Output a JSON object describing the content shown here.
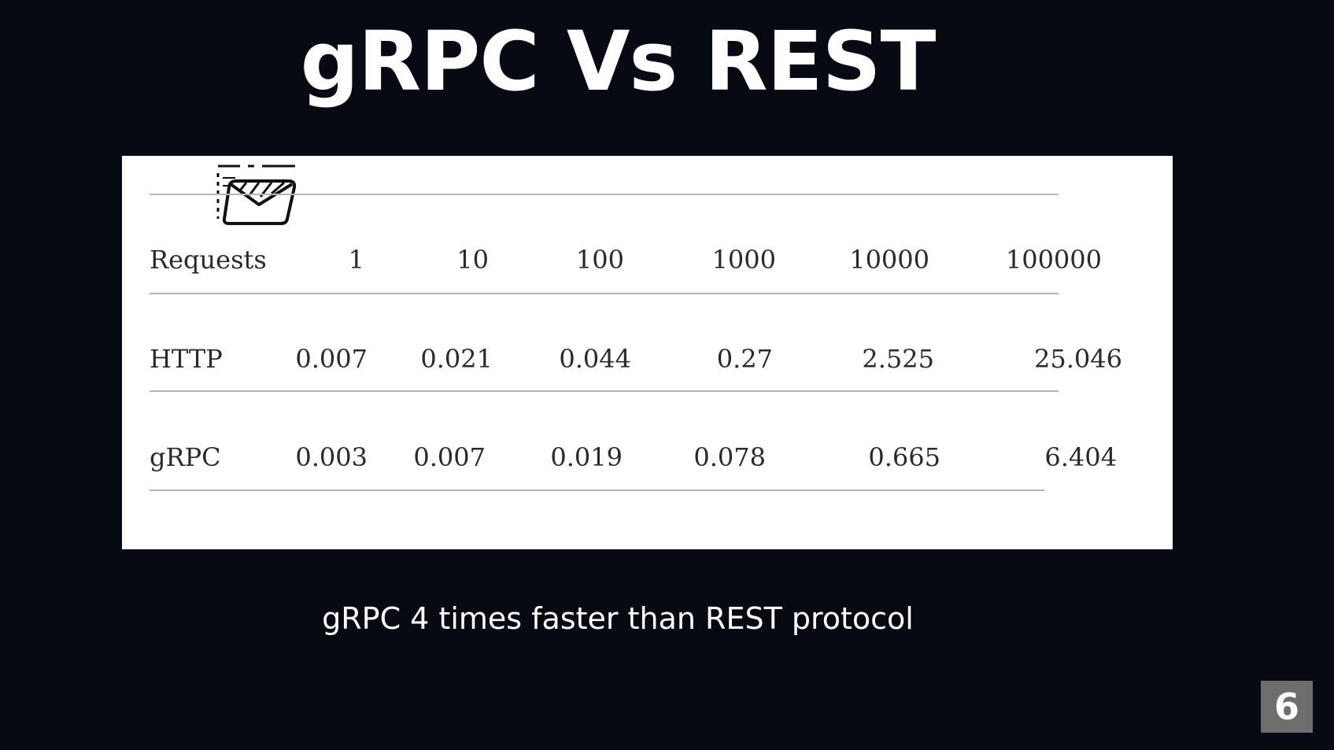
{
  "title": "gRPC Vs REST",
  "table": {
    "header": {
      "label": "Requests",
      "values": [
        "1",
        "10",
        "100",
        "1000",
        "10000",
        "100000"
      ]
    },
    "rows": [
      {
        "label": "HTTP",
        "values": [
          "0.007",
          "0.021",
          "0.044",
          "0.27",
          "2.525",
          "25.046"
        ]
      },
      {
        "label": "gRPC",
        "values": [
          "0.003",
          "0.007",
          "0.019",
          "0.078",
          "0.665",
          "6.404"
        ]
      }
    ]
  },
  "caption": "gRPC 4 times faster than REST protocol",
  "page_number": "6",
  "icons": {
    "table_overlay": "envelope-icon"
  },
  "colors": {
    "background": "#070a12",
    "panel": "#ffffff",
    "text_light": "#ffffff",
    "table_text": "#2a2a2a",
    "badge": "#6e6e6e"
  }
}
